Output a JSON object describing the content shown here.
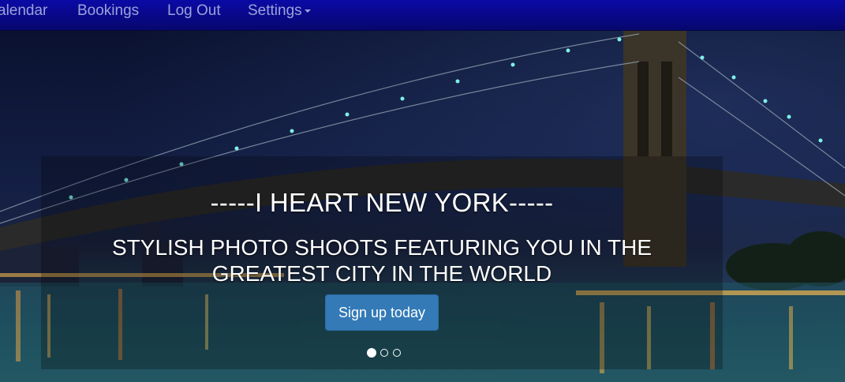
{
  "nav": {
    "items": [
      {
        "label": "alendar"
      },
      {
        "label": "Bookings"
      },
      {
        "label": "Log Out"
      },
      {
        "label": "Settings"
      }
    ]
  },
  "carousel": {
    "headline": "-----I HEART NEW YORK-----",
    "subline": "STYLISH PHOTO SHOOTS FEATURING YOU IN THE GREATEST CITY IN THE WORLD",
    "cta_label": "Sign up today",
    "slides": 3,
    "active_slide": 1
  },
  "colors": {
    "navbar": "#0a0aa6",
    "cta": "#337ab7",
    "nav_text": "#9aa3d8"
  }
}
